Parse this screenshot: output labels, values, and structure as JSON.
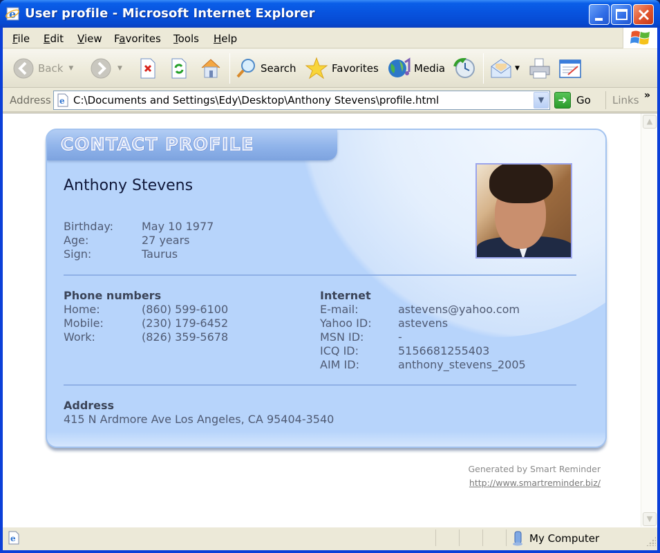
{
  "window": {
    "title": "User profile - Microsoft Internet Explorer"
  },
  "menu": {
    "items": [
      {
        "label": "File",
        "accel": "F",
        "rest": "ile"
      },
      {
        "label": "Edit",
        "accel": "E",
        "rest": "dit"
      },
      {
        "label": "View",
        "accel": "V",
        "rest": "iew"
      },
      {
        "label": "Favorites",
        "pre": "F",
        "accel": "a",
        "rest": "vorites"
      },
      {
        "label": "Tools",
        "accel": "T",
        "rest": "ools"
      },
      {
        "label": "Help",
        "accel": "H",
        "rest": "elp"
      }
    ]
  },
  "toolbar": {
    "back_label": "Back",
    "search_label": "Search",
    "favorites_label": "Favorites",
    "media_label": "Media"
  },
  "address": {
    "label": "Address",
    "value": "C:\\Documents and Settings\\Edy\\Desktop\\Anthony Stevens\\profile.html",
    "go_label": "Go",
    "links_label": "Links"
  },
  "profile": {
    "header": "CONTACT PROFILE",
    "name": "Anthony Stevens",
    "personal": [
      {
        "label": "Birthday:",
        "value": "May 10 1977"
      },
      {
        "label": "Age:",
        "value": "27 years"
      },
      {
        "label": "Sign:",
        "value": "Taurus"
      }
    ],
    "phones": {
      "title": "Phone numbers",
      "items": [
        {
          "label": "Home:",
          "value": "(860) 599-6100"
        },
        {
          "label": "Mobile:",
          "value": "(230) 179-6452"
        },
        {
          "label": "Work:",
          "value": "(826) 359-5678"
        }
      ]
    },
    "internet": {
      "title": "Internet",
      "items": [
        {
          "label": "E-mail:",
          "value": "astevens@yahoo.com"
        },
        {
          "label": "Yahoo ID:",
          "value": "astevens"
        },
        {
          "label": "MSN ID:",
          "value": "-"
        },
        {
          "label": "ICQ ID:",
          "value": "5156681255403"
        },
        {
          "label": "AIM ID:",
          "value": "anthony_stevens_2005"
        }
      ]
    },
    "address": {
      "title": "Address",
      "value": "415 N Ardmore Ave Los Angeles, CA 95404-3540"
    }
  },
  "footer": {
    "generated_by": "Generated by Smart Reminder",
    "link": "http://www.smartreminder.biz/"
  },
  "status": {
    "zone": "My Computer"
  },
  "colors": {
    "title_bar": "#0852dd",
    "card_bg": "#b7d4fb",
    "text": "#4f5a73"
  }
}
